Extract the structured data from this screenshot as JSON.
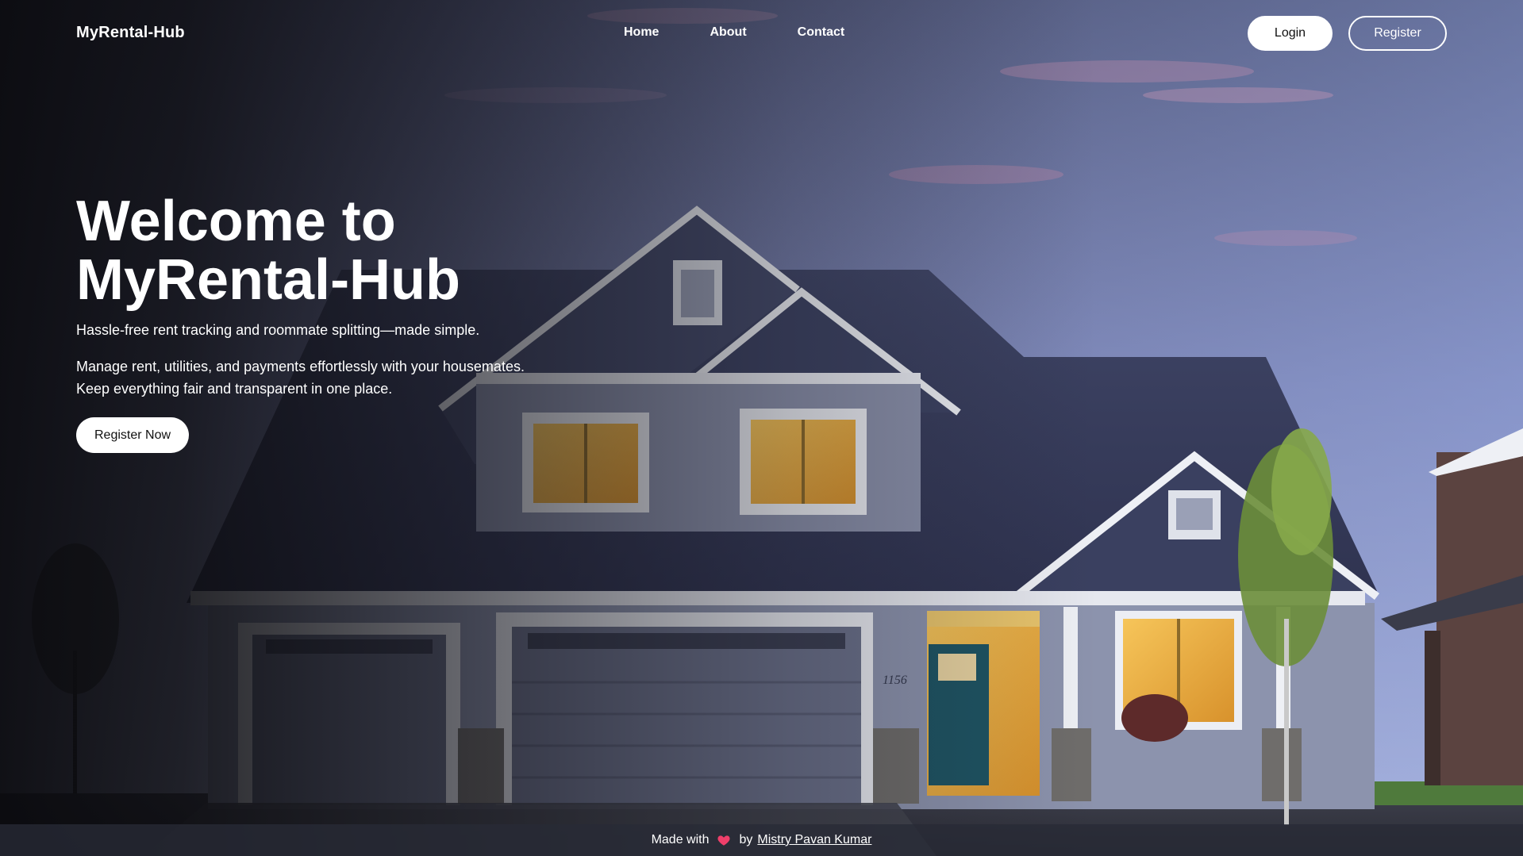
{
  "header": {
    "brand": "MyRental-Hub",
    "nav": [
      "Home",
      "About",
      "Contact"
    ],
    "login_label": "Login",
    "register_label": "Register"
  },
  "hero": {
    "title_line1": "Welcome to",
    "title_line2": "MyRental-Hub",
    "tagline": "Hassle-free rent tracking and roommate splitting—made simple.",
    "desc_line1": "Manage rent, utilities, and payments effortlessly with your housemates.",
    "desc_line2": "Keep everything fair and transparent in one place.",
    "cta_label": "Register Now"
  },
  "house": {
    "number": "1156"
  },
  "footer": {
    "made_with": "Made with",
    "heart_icon": "heart-icon",
    "by": "by",
    "author": "Mistry Pavan Kumar"
  },
  "colors": {
    "sky_top": "#4c5170",
    "sky_bottom": "#9aa6d6",
    "roof": "#3a3f5c",
    "window_glow": "#f0b64a",
    "door": "#1e5463",
    "button_bg": "#ffffff"
  }
}
